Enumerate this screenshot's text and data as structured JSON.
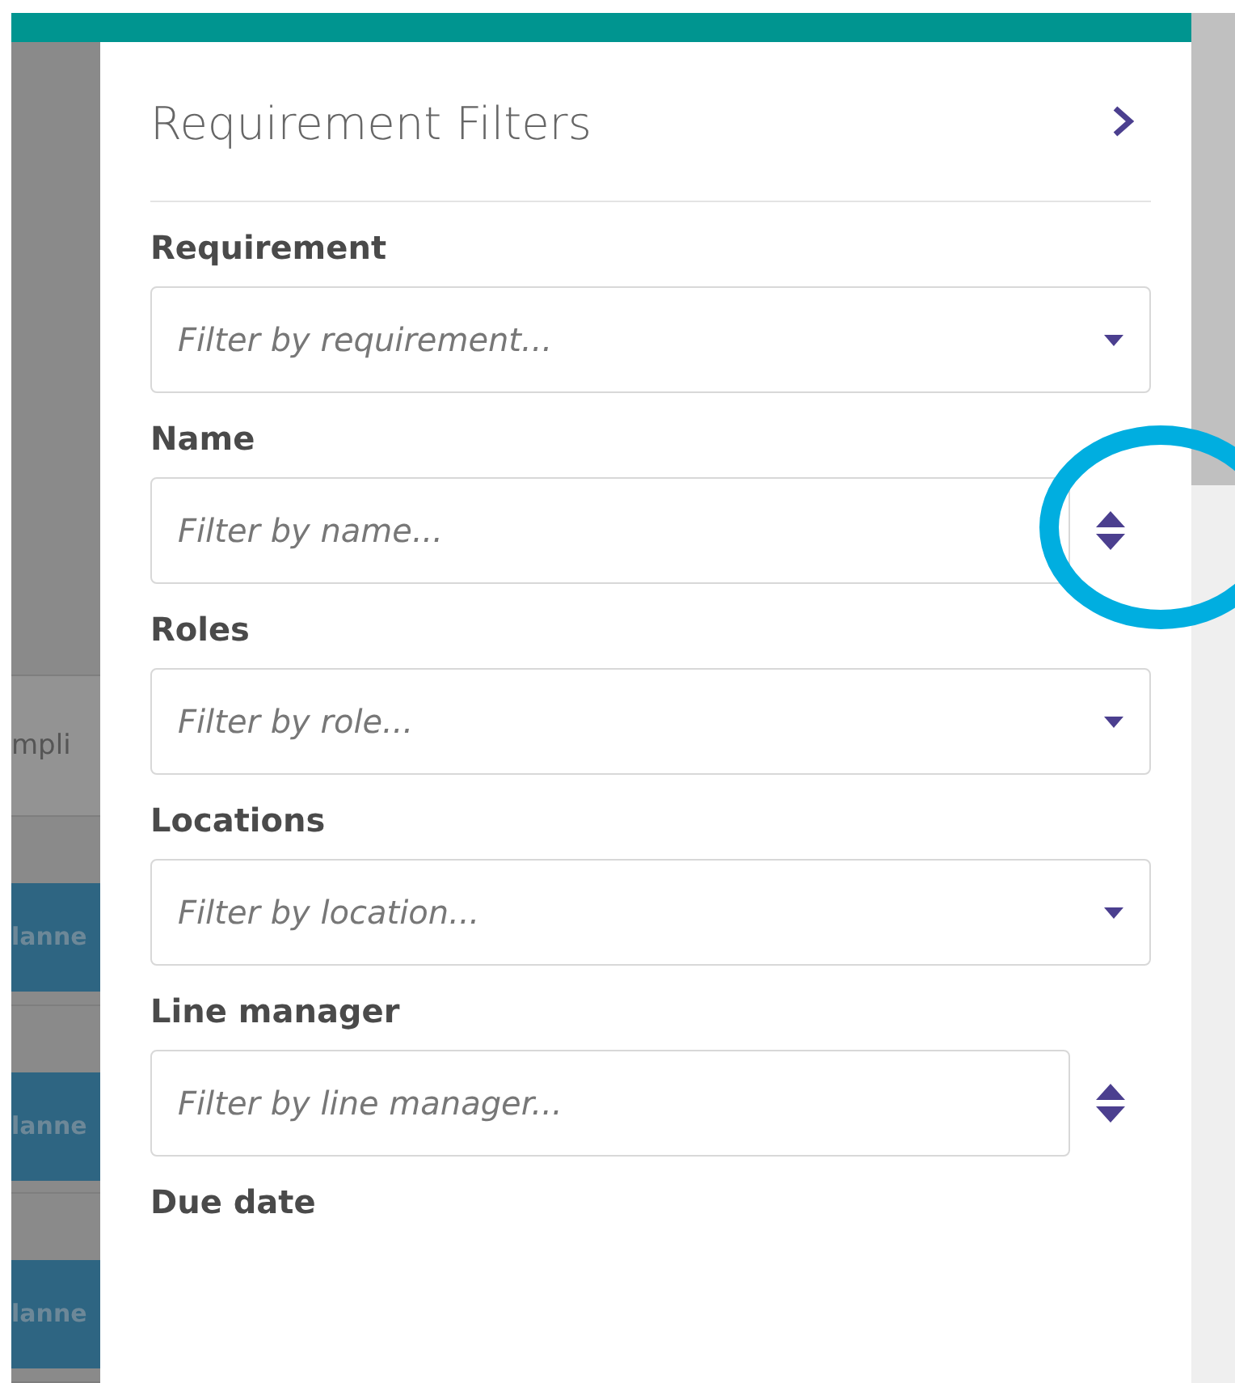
{
  "background_rows": [
    {
      "text": "mpli",
      "kind": "plain"
    },
    {
      "text": "lanne",
      "kind": "status"
    },
    {
      "text": "lanne",
      "kind": "status"
    },
    {
      "text": "lanne",
      "kind": "status"
    }
  ],
  "panel": {
    "title": "Requirement Filters",
    "filters": [
      {
        "label": "Requirement",
        "placeholder": "Filter by requirement...",
        "kind": "select",
        "highlighted": false
      },
      {
        "label": "Name",
        "placeholder": "Filter by name...",
        "kind": "sort",
        "highlighted": true
      },
      {
        "label": "Roles",
        "placeholder": "Filter by role...",
        "kind": "select",
        "highlighted": false
      },
      {
        "label": "Locations",
        "placeholder": "Filter by location...",
        "kind": "select",
        "highlighted": false
      },
      {
        "label": "Line manager",
        "placeholder": "Filter by line manager...",
        "kind": "sort",
        "highlighted": false
      }
    ],
    "next_label": "Due date"
  }
}
